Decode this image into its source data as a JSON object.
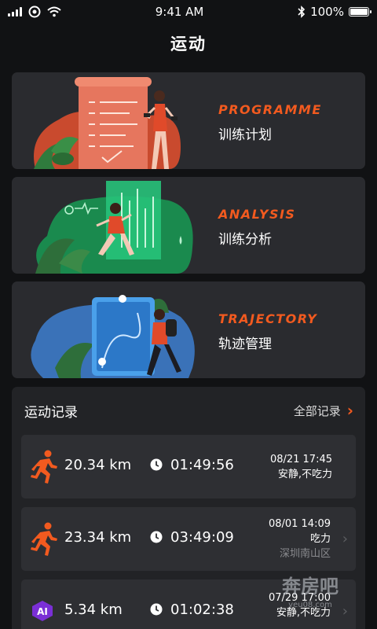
{
  "status_bar": {
    "time": "9:41 AM",
    "battery": "100%",
    "battery_level": 1.0
  },
  "page": {
    "title": "运动"
  },
  "features": [
    {
      "title_en": "PROGRAMME",
      "title_zh": "训练计划",
      "accent": "#f25a1f",
      "blob": "#e8573a"
    },
    {
      "title_en": "ANALYSIS",
      "title_zh": "训练分析",
      "accent": "#f25a1f",
      "blob": "#1f9e5a"
    },
    {
      "title_en": "TRAJECTORY",
      "title_zh": "轨迹管理",
      "accent": "#f25a1f",
      "blob": "#3f7fc8"
    }
  ],
  "records": {
    "title": "运动记录",
    "all_label": "全部记录",
    "items": [
      {
        "icon": "runner-icon",
        "distance": "20.34 km",
        "duration": "01:49:56",
        "datetime": "08/21 17:45",
        "note": "安静,不吃力",
        "location": ""
      },
      {
        "icon": "runner-icon",
        "distance": "23.34 km",
        "duration": "03:49:09",
        "datetime": "08/01 14:09",
        "note": "吃力",
        "location": "深圳南山区"
      },
      {
        "icon": "ai-badge-icon",
        "badge": "AI",
        "distance": "5.34 km",
        "duration": "01:02:38",
        "datetime": "07/29 17:00",
        "note": "安静,不吃力",
        "location": ""
      }
    ]
  },
  "watermark": {
    "text": "奔房吧",
    "sub": "yeu08.com"
  },
  "colors": {
    "background": "#111214",
    "card": "#2a2b2f",
    "accent": "#f25a1f"
  }
}
